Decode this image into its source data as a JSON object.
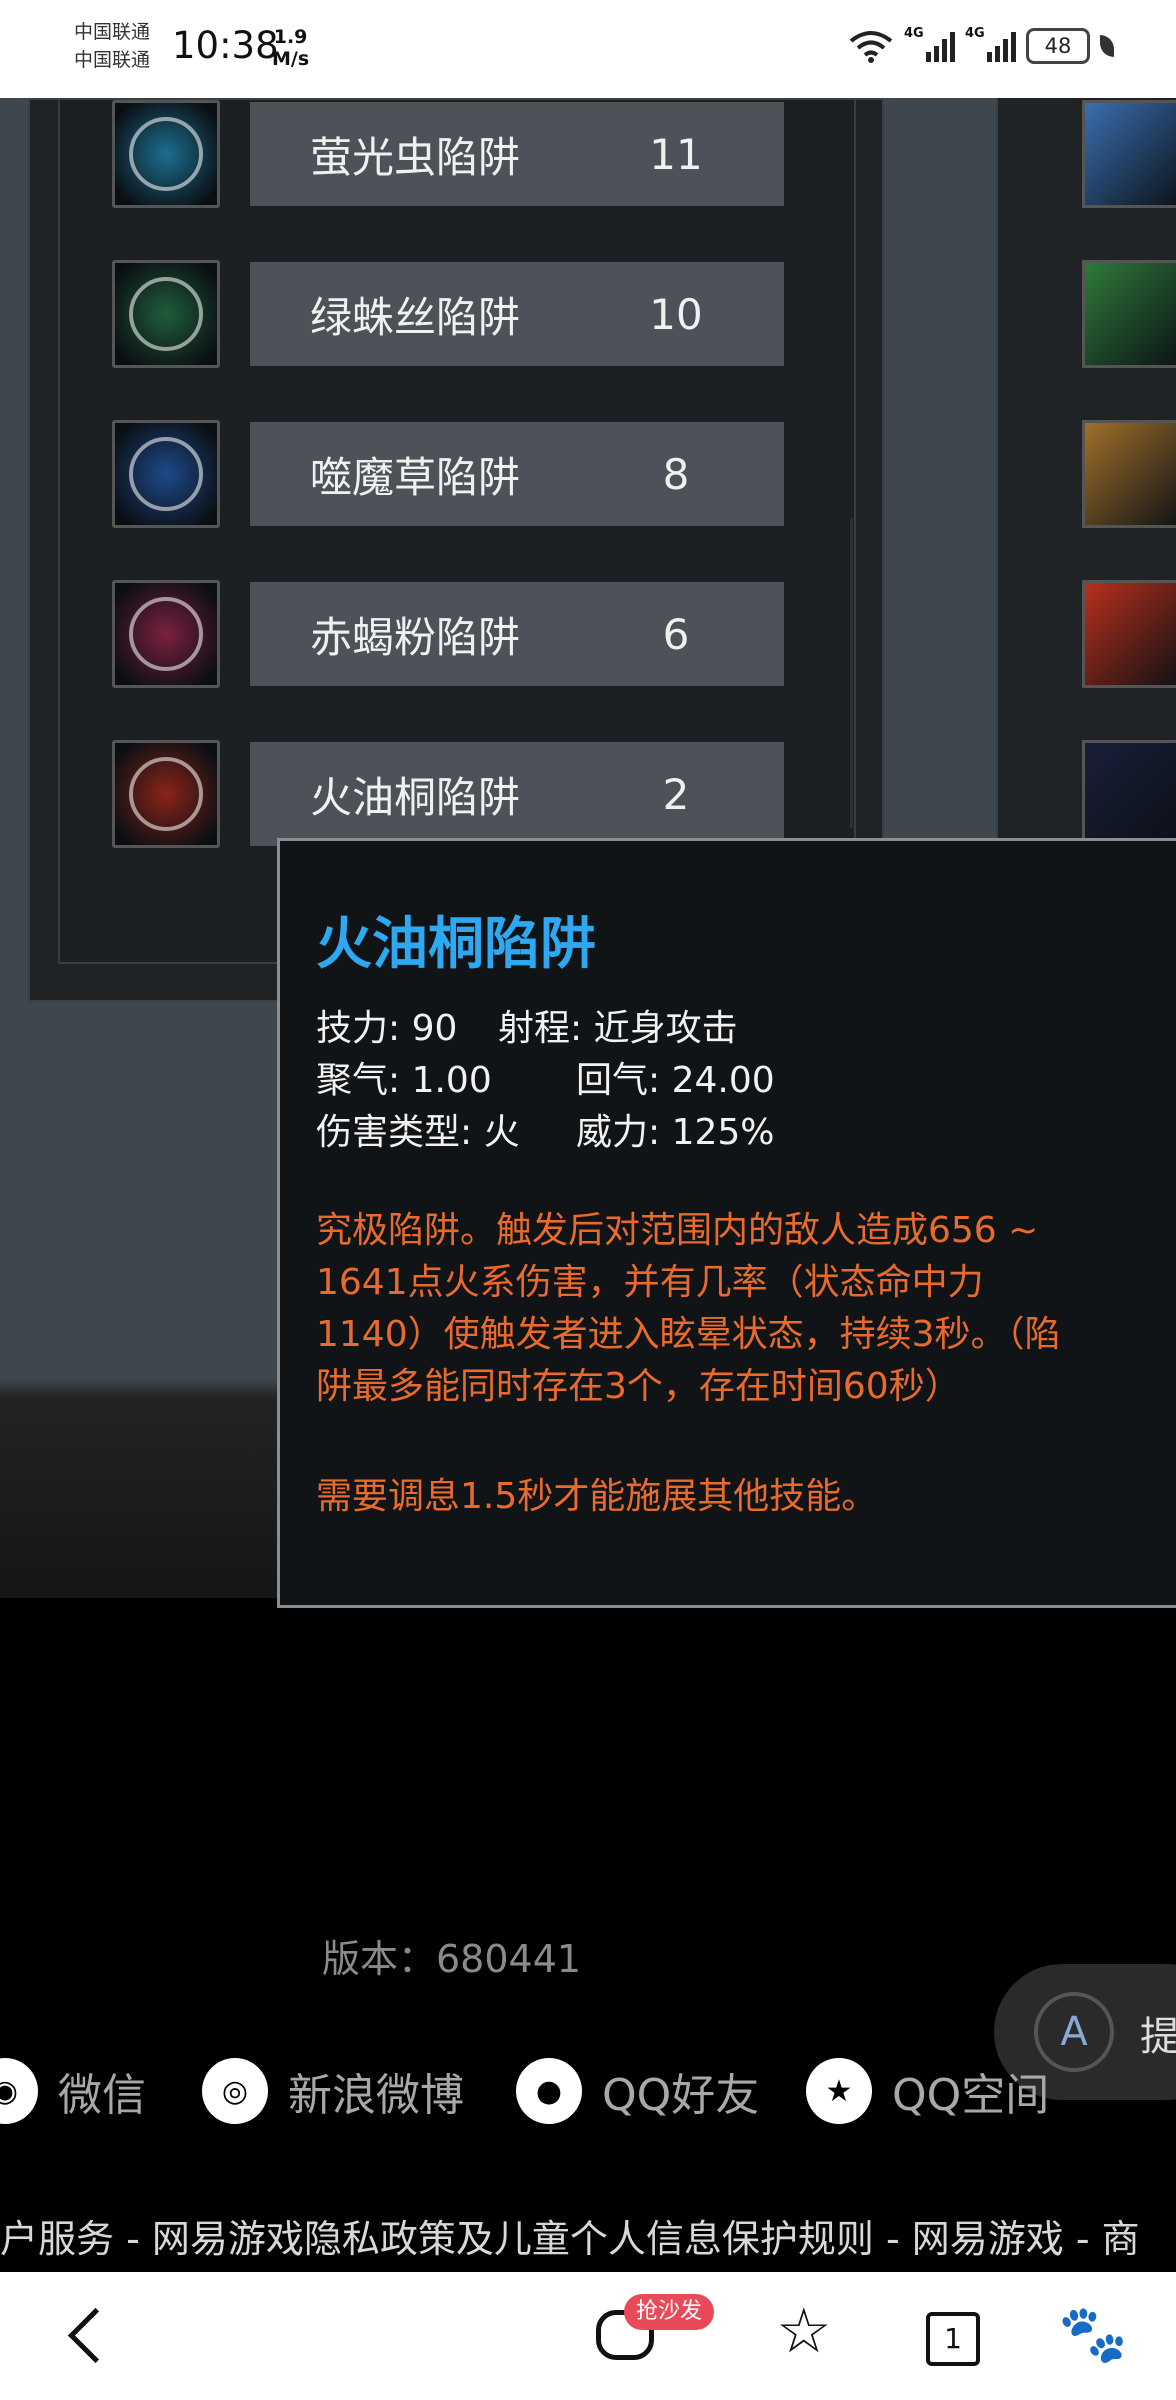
{
  "status_bar": {
    "carrier_1": "中国联通",
    "carrier_2": "中国联通",
    "time": "10:38",
    "net_speed_value": "1.9",
    "net_speed_unit": "M/s",
    "signal_1_label": "4G",
    "signal_2_label": "4G",
    "battery": "48",
    "icons": [
      "wifi-icon",
      "signal-icon",
      "signal-icon",
      "battery-icon",
      "leaf-icon"
    ]
  },
  "skills": [
    {
      "name": "萤光虫陷阱",
      "level": "11",
      "icon": "firefly-trap-icon",
      "color": "#1b6f8f"
    },
    {
      "name": "绿蛛丝陷阱",
      "level": "10",
      "icon": "green-spider-trap-icon",
      "color": "#1f5d3a"
    },
    {
      "name": "噬魔草陷阱",
      "level": "8",
      "icon": "demon-grass-trap-icon",
      "color": "#1d4a8a"
    },
    {
      "name": "赤蝎粉陷阱",
      "level": "6",
      "icon": "scorpion-trap-icon",
      "color": "#7a2040"
    },
    {
      "name": "火油桐陷阱",
      "level": "2",
      "icon": "fire-oil-trap-icon",
      "color": "#8a2418"
    }
  ],
  "right_column_icons": [
    "arrows-skill-icon",
    "green-arrow-skill-icon",
    "golden-shot-skill-icon",
    "fire-shot-skill-icon",
    "dark-skill-icon"
  ],
  "tooltip": {
    "title": "火油桐陷阱",
    "stats": {
      "skill_power": "技力: 90",
      "range": "射程: 近身攻击",
      "gather": "聚气: 1.00",
      "recover": "回气: 24.00",
      "damage_type": "伤害类型: 火",
      "power": "威力: 125%"
    },
    "description_lines": [
      "究极陷阱。触发后对范围内的敌人造成656 ~",
      "1641点火系伤害，并有几率（状态命中力",
      "1140）使触发者进入眩晕状态，持续3秒。（陷",
      "阱最多能同时存在3个，存在时间60秒）"
    ],
    "note": "需要调息1.5秒才能施展其他技能。",
    "title_color": "#2ea8f0",
    "text_color": "#e86a2c"
  },
  "version": "版本：680441",
  "float_button": {
    "icon": "A",
    "label": "提"
  },
  "share": [
    {
      "label": "微信",
      "icon": "wechat-icon",
      "glyph": "◉"
    },
    {
      "label": "新浪微博",
      "icon": "weibo-icon",
      "glyph": "◎"
    },
    {
      "label": "QQ好友",
      "icon": "qq-icon",
      "glyph": "●"
    },
    {
      "label": "QQ空间",
      "icon": "qzone-icon",
      "glyph": "★"
    }
  ],
  "footer_links": "户服务 - 网易游戏隐私政策及儿童个人信息保护规则 - 网易游戏 - 商",
  "nav": {
    "comment_badge": "抢沙发",
    "tab_count": "1",
    "star_glyph": "☆",
    "paw_glyph": "🐾"
  }
}
